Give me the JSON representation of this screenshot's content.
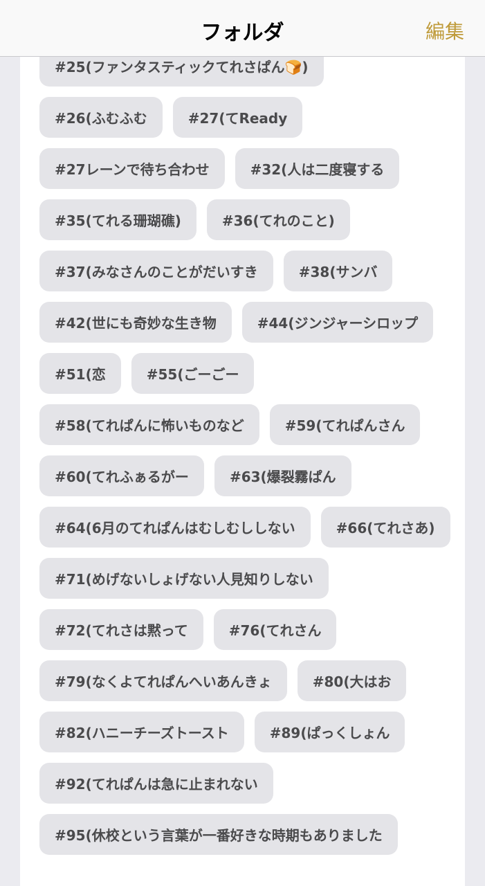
{
  "navbar": {
    "title": "フォルダ",
    "edit_label": "編集"
  },
  "tags": [
    "#25(ファンタスティックてれさぱん🍞)",
    "#26(ふむふむ",
    "#27(てReady",
    "#27レーンで待ち合わせ",
    "#32(人は二度寝する",
    "#35(てれる珊瑚礁)",
    "#36(てれのこと)",
    "#37(みなさんのことがだいすき",
    "#38(サンバ",
    "#42(世にも奇妙な生き物",
    "#44(ジンジャーシロップ",
    "#51(恋",
    "#55(ごーごー",
    "#58(てれぱんに怖いものなど",
    "#59(てれぱんさん",
    "#60(てれふぁるがー",
    "#63(爆裂霧ぱん",
    "#64(6月のてれぱんはむしむししない",
    "#66(てれさあ)",
    "#71(めげないしょげない人見知りしない",
    "#72(てれさは黙って",
    "#76(てれさん",
    "#79(なくよてれぱんへいあんきょ",
    "#80(大はお",
    "#82(ハニーチーズトースト",
    "#89(ぱっくしょん",
    "#92(てれぱんは急に止まれない",
    "#95(休校という言葉が一番好きな時期もありました"
  ]
}
